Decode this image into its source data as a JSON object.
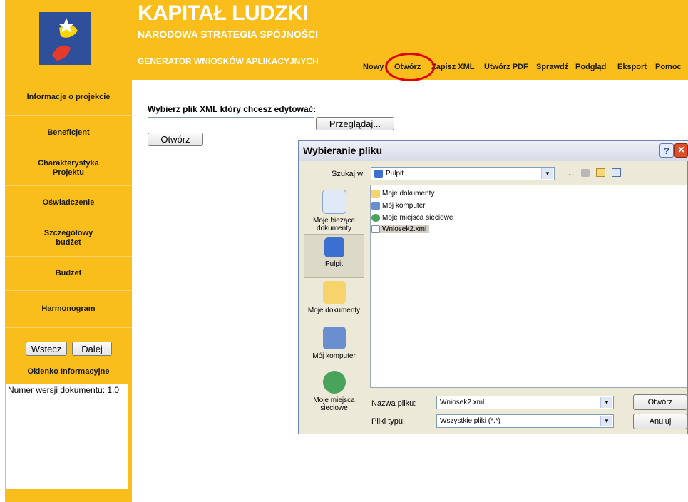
{
  "brand": {
    "title": "KAPITAŁ LUDZKI",
    "subtitle": "NARODOWA STRATEGIA SPÓJNOŚCI",
    "generator": "GENERATOR WNIOSKÓW APLIKACYJNYCH"
  },
  "menu": [
    "Nowy",
    "Otwórz",
    "Zapisz XML",
    "Utwórz PDF",
    "Sprawdź",
    "Podgląd",
    "Eksport",
    "Pomoc"
  ],
  "sidebar": {
    "items": [
      "Informacje o projekcie",
      "Beneficjent",
      "Charakterystyka Projektu",
      "Oświadczenie",
      "Szczegółowy budżet",
      "Budżet",
      "Harmonogram"
    ],
    "back_label": "Wstecz",
    "next_label": "Dalej",
    "info_title": "Okienko Informacyjne",
    "info_text": "Numer wersji dokumentu: 1.0"
  },
  "main": {
    "prompt": "Wybierz plik XML który chcesz edytować:",
    "file_value": "",
    "browse_label": "Przeglądaj...",
    "open_label": "Otwórz"
  },
  "dialog": {
    "title": "Wybieranie pliku",
    "look_in_label": "Szukaj w:",
    "look_in_value": "Pulpit",
    "places": [
      "Moje bieżące dokumenty",
      "Pulpit",
      "Moje dokumenty",
      "Mój komputer",
      "Moje miejsca sieciowe"
    ],
    "files": [
      "Moje dokumenty",
      "Mój komputer",
      "Moje miejsca sieciowe",
      "Wniosek2.xml"
    ],
    "filename_label": "Nazwa pliku:",
    "filename_value": "Wniosek2.xml",
    "filetype_label": "Pliki typu:",
    "filetype_value": "Wszystkie pliki (*.*)",
    "open_label": "Otwórz",
    "cancel_label": "Anuluj",
    "help_glyph": "?",
    "close_glyph": "×"
  }
}
